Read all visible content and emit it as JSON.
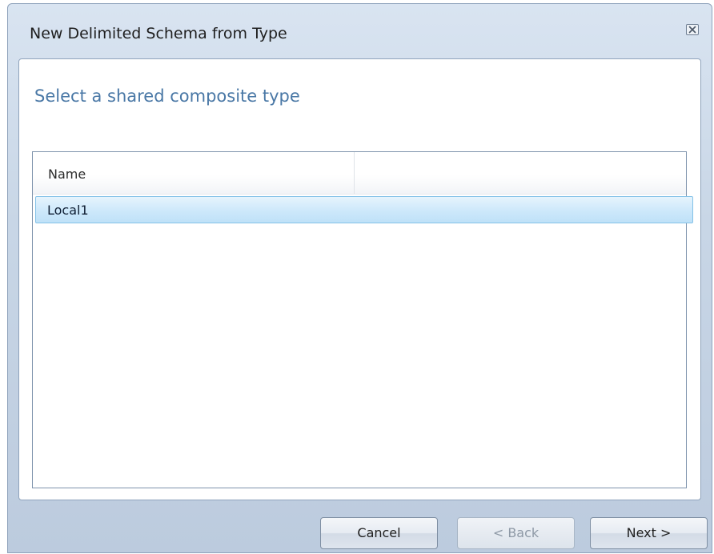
{
  "window": {
    "title": "New Delimited Schema from Type"
  },
  "page": {
    "heading": "Select a shared composite type"
  },
  "list": {
    "columns": [
      "Name",
      ""
    ],
    "rows": [
      {
        "name": "Local1",
        "selected": true
      }
    ]
  },
  "buttons": {
    "cancel_label": "Cancel",
    "back_label": "< Back",
    "next_label": "Next >"
  },
  "icons": {
    "close": "close-icon"
  },
  "colors": {
    "heading": "#4a78a6",
    "selection": "#cfe9fb",
    "selection_border": "#84c2e8"
  }
}
